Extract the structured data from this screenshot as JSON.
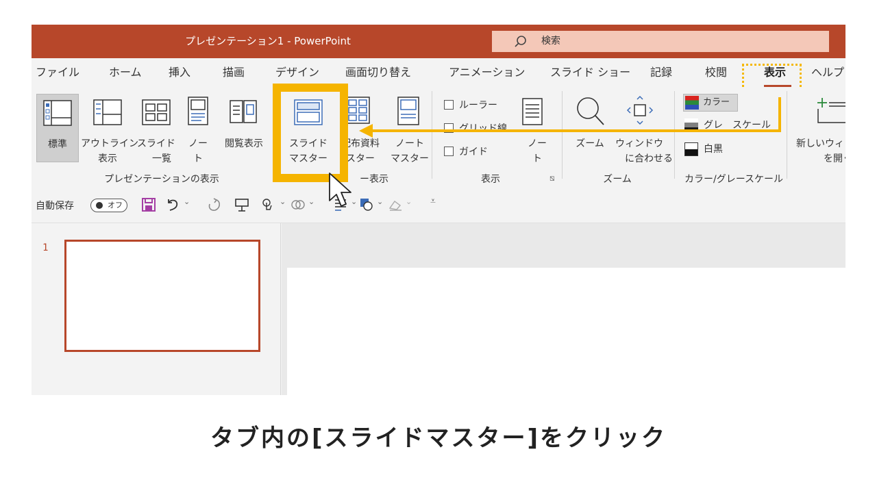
{
  "titlebar": {
    "title": "プレゼンテーション1  -  PowerPoint",
    "search_placeholder": "検索",
    "bg_color": "#b7472a"
  },
  "tabs": [
    {
      "label": "ファイル"
    },
    {
      "label": "ホーム"
    },
    {
      "label": "挿入"
    },
    {
      "label": "描画"
    },
    {
      "label": "デザイン"
    },
    {
      "label": "画面切り替え"
    },
    {
      "label": "アニメーション"
    },
    {
      "label": "スライド ショー"
    },
    {
      "label": "記録"
    },
    {
      "label": "校閲"
    },
    {
      "label": "表示",
      "active": true
    },
    {
      "label": "ヘルプ"
    }
  ],
  "ribbon": {
    "presentation_views": {
      "group_label": "プレゼンテーションの表示",
      "normal": "標準",
      "outline_1": "アウトライン",
      "outline_2": "表示",
      "sorter_1": "スライド",
      "sorter_2": "一覧",
      "notes_1": "ノー",
      "notes_2": "ト",
      "reading": "閲覧表示"
    },
    "master_views": {
      "group_label": "ー表示",
      "slide_master_1": "スライド",
      "slide_master_2": "マスター",
      "handout_1": "配布資料",
      "handout_2": "スター",
      "notes_master_1": "ノート",
      "notes_master_2": "マスター",
      "handout_prefix": "配"
    },
    "show": {
      "group_label": "表示",
      "ruler": "ルーラー",
      "gridlines": "グリッド線",
      "guides": "ガイド",
      "notes_1": "ノー",
      "notes_2": "ト"
    },
    "zoom": {
      "group_label": "ズーム",
      "zoom": "ズーム",
      "fit_1": "ウィンドウ",
      "fit_2": "に合わせる"
    },
    "color": {
      "group_label": "カラー/グレースケール",
      "color": "カラー",
      "grayscale": "グレ　スケール",
      "bw": "白黒"
    },
    "window": {
      "new_window_1": "新しいウィン",
      "new_window_2": "を開く"
    }
  },
  "qat": {
    "autosave_label": "自動保存",
    "toggle_label": "オフ"
  },
  "thumbnails": {
    "slide_number": "1"
  },
  "instruction": {
    "caption": "タブ内の[スライドマスター]をクリック",
    "highlight_color": "#f5b400"
  }
}
